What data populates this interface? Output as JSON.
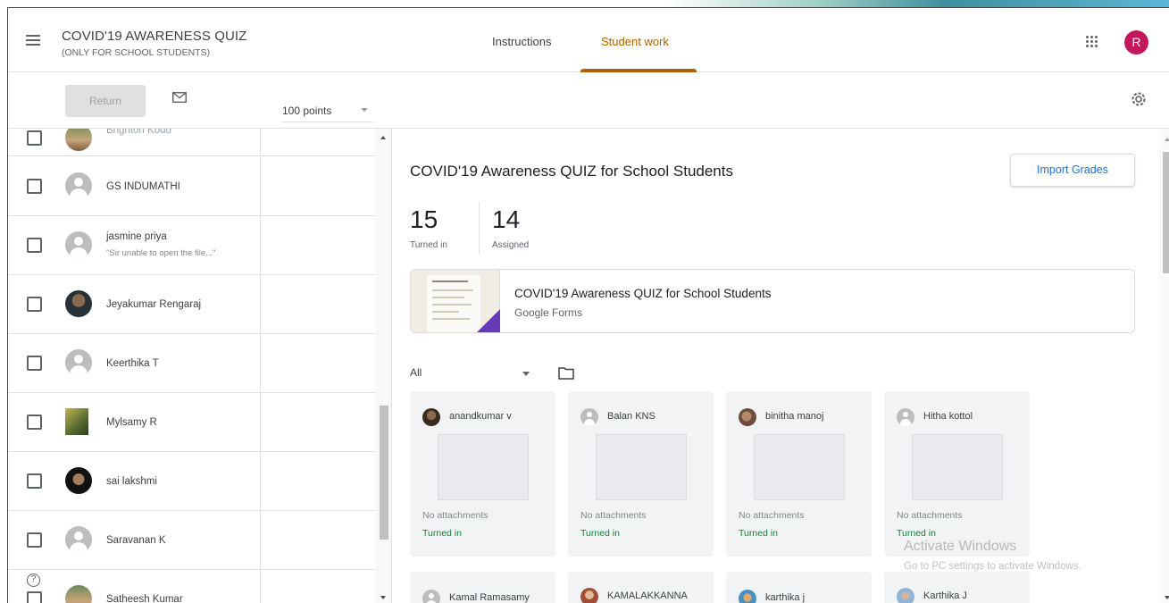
{
  "header": {
    "title": "COVID'19 AWARENESS QUIZ",
    "subtitle": "(ONLY FOR SCHOOL STUDENTS)",
    "tabs": [
      {
        "label": "Instructions",
        "active": false
      },
      {
        "label": "Student work",
        "active": true
      }
    ],
    "account_initial": "R",
    "account_color": "#c2185b",
    "accent_color": "#b06000"
  },
  "toolbar": {
    "return_label": "Return",
    "points_value": "100 points"
  },
  "students": [
    {
      "name": "Brighton Kodo",
      "comment": "",
      "avatar": "photo4"
    },
    {
      "name": "GS INDUMATHI",
      "comment": "",
      "avatar": "grey"
    },
    {
      "name": "jasmine priya",
      "comment": "\"Sir unable to open the file...\"",
      "avatar": "grey"
    },
    {
      "name": "Jeyakumar Rengaraj",
      "comment": "",
      "avatar": "photo1"
    },
    {
      "name": "Keerthika T",
      "comment": "",
      "avatar": "grey"
    },
    {
      "name": "Mylsamy R",
      "comment": "",
      "avatar": "photo3"
    },
    {
      "name": "sai lakshmi",
      "comment": "",
      "avatar": "photo2"
    },
    {
      "name": "Saravanan K",
      "comment": "",
      "avatar": "grey"
    },
    {
      "name": "Satheesh Kumar",
      "comment": "",
      "avatar": "photo4"
    }
  ],
  "assignment": {
    "title": "COVID'19 Awareness QUIZ for School Students",
    "import_label": "Import Grades",
    "turned_in_count": "15",
    "turned_in_label": "Turned in",
    "assigned_count": "14",
    "assigned_label": "Assigned",
    "attachment_title": "COVID'19 Awareness QUIZ for School Students",
    "attachment_type": "Google Forms",
    "attachment_type_color": "#673ab7",
    "filter_value": "All"
  },
  "cards": [
    {
      "name": "anandkumar v",
      "avatar": "p1",
      "note": "No attachments",
      "status": "Turned in"
    },
    {
      "name": "Balan KNS",
      "avatar": "grey",
      "note": "No attachments",
      "status": "Turned in"
    },
    {
      "name": "binitha manoj",
      "avatar": "p2",
      "note": "No attachments",
      "status": "Turned in"
    },
    {
      "name": "Hitha kottol",
      "avatar": "grey",
      "note": "No attachments",
      "status": "Turned in"
    },
    {
      "name": "Kamal Ramasamy",
      "avatar": "grey",
      "note": "",
      "status": ""
    },
    {
      "name": "KAMALAKKANNA",
      "avatar": "p3",
      "note": "",
      "status": ""
    },
    {
      "name": "karthika j",
      "avatar": "p4",
      "note": "",
      "status": ""
    },
    {
      "name": "Karthika J",
      "avatar": "p5",
      "note": "",
      "status": ""
    }
  ],
  "status_color": "#188038",
  "watermark": {
    "line1": "Activate Windows",
    "line2": "Go to PC settings to activate Windows."
  },
  "icons": [
    "hamburger-menu-icon",
    "apps-grid-icon",
    "mail-icon",
    "dropdown-arrow-icon",
    "settings-gear-icon",
    "help-icon",
    "folder-icon"
  ]
}
